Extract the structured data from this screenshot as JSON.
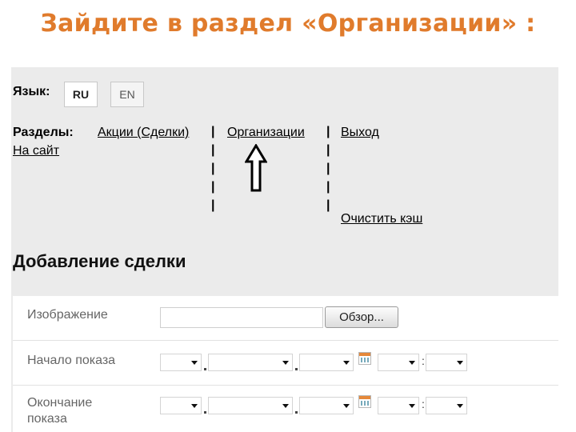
{
  "slide": {
    "title": "Зайдите в раздел «Организации» :"
  },
  "lang": {
    "label": "Язык:",
    "ru": "RU",
    "en": "EN"
  },
  "nav": {
    "label": "Разделы:",
    "deals": "Акции (Сделки)",
    "organizations": "Организации",
    "exit": "Выход",
    "site": "На сайт",
    "clear_cache": "Очистить кэш",
    "separator": "|"
  },
  "page": {
    "heading": "Добавление сделки"
  },
  "form": {
    "image_label": "Изображение",
    "browse_label": "Обзор...",
    "start_label": "Начало показа",
    "end_label": "Окончание показа",
    "colon": ":"
  },
  "icons": {
    "arrow": "arrow-up-icon",
    "calendar": "calendar-icon",
    "dropdown": "chevron-down-icon"
  },
  "colors": {
    "title": "#e07b2c",
    "panel": "#ebebeb"
  }
}
